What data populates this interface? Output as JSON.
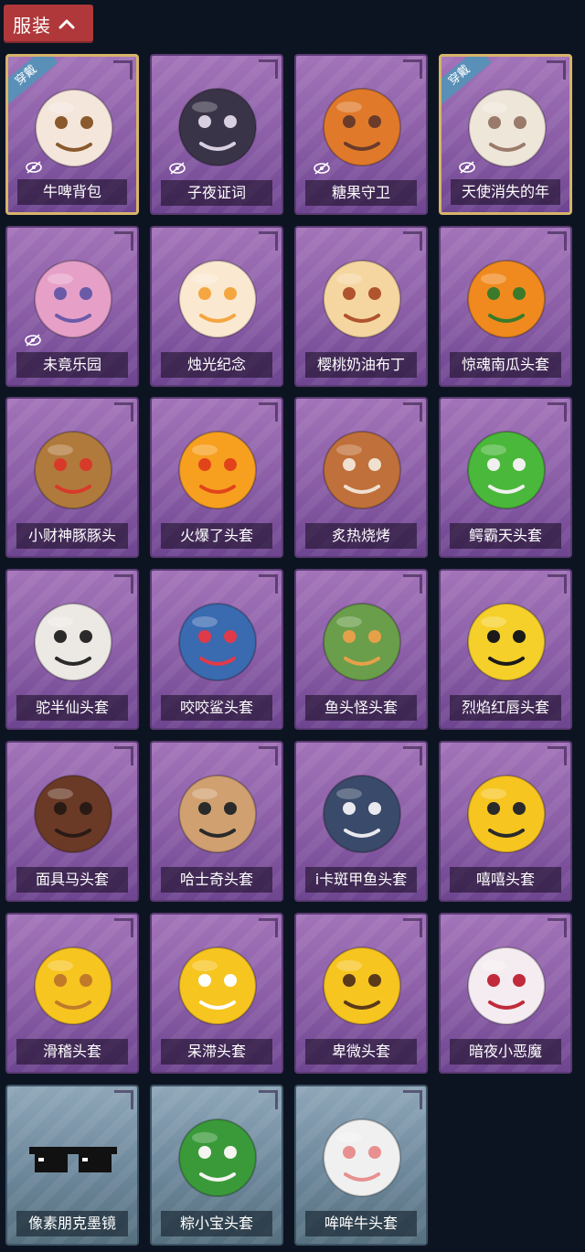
{
  "header": {
    "title": "服装"
  },
  "equipped_label": "穿戴",
  "items": [
    {
      "name": "牛啤背包",
      "icon": "cow-beer-backpack",
      "theme": "purple",
      "equipped": true,
      "hidden": true
    },
    {
      "name": "子夜证词",
      "icon": "owl-witch-figure",
      "theme": "purple",
      "equipped": false,
      "hidden": true
    },
    {
      "name": "糖果守卫",
      "icon": "pumpkin-scarecrow",
      "theme": "purple",
      "equipped": false,
      "hidden": true
    },
    {
      "name": "天使消失的年",
      "icon": "angel-girl",
      "theme": "purple",
      "equipped": true,
      "hidden": true
    },
    {
      "name": "未竟乐园",
      "icon": "pink-hair-girl",
      "theme": "purple",
      "equipped": false,
      "hidden": true
    },
    {
      "name": "烛光纪念",
      "icon": "candle-head",
      "theme": "purple",
      "equipped": false,
      "hidden": false
    },
    {
      "name": "樱桃奶油布丁",
      "icon": "cherry-pudding-head",
      "theme": "purple",
      "equipped": false,
      "hidden": false
    },
    {
      "name": "惊魂南瓜头套",
      "icon": "pumpkin-head",
      "theme": "purple",
      "equipped": false,
      "hidden": false
    },
    {
      "name": "小财神豚豚头",
      "icon": "capybara-head",
      "theme": "purple",
      "equipped": false,
      "hidden": false
    },
    {
      "name": "火爆了头套",
      "icon": "fire-head",
      "theme": "purple",
      "equipped": false,
      "hidden": false
    },
    {
      "name": "炙热烧烤",
      "icon": "bbq-meat-head",
      "theme": "purple",
      "equipped": false,
      "hidden": false
    },
    {
      "name": "鳄霸天头套",
      "icon": "crocodile-head",
      "theme": "purple",
      "equipped": false,
      "hidden": false
    },
    {
      "name": "驼半仙头套",
      "icon": "polar-bear-head",
      "theme": "purple",
      "equipped": false,
      "hidden": false
    },
    {
      "name": "咬咬鲨头套",
      "icon": "shark-head",
      "theme": "purple",
      "equipped": false,
      "hidden": false
    },
    {
      "name": "鱼头怪头套",
      "icon": "fish-head",
      "theme": "purple",
      "equipped": false,
      "hidden": false
    },
    {
      "name": "烈焰红唇头套",
      "icon": "pikachu-mask-head",
      "theme": "purple",
      "equipped": false,
      "hidden": false
    },
    {
      "name": "面具马头套",
      "icon": "horse-head",
      "theme": "purple",
      "equipped": false,
      "hidden": false
    },
    {
      "name": "哈士奇头套",
      "icon": "husky-head",
      "theme": "purple",
      "equipped": false,
      "hidden": false
    },
    {
      "name": "i卡斑甲鱼头套",
      "icon": "whale-head",
      "theme": "purple",
      "equipped": false,
      "hidden": false
    },
    {
      "name": "嘻嘻头套",
      "icon": "grin-emoji-head",
      "theme": "purple",
      "equipped": false,
      "hidden": false
    },
    {
      "name": "滑稽头套",
      "icon": "smirk-emoji-head",
      "theme": "purple",
      "equipped": false,
      "hidden": false
    },
    {
      "name": "呆滞头套",
      "icon": "stare-emoji-head",
      "theme": "purple",
      "equipped": false,
      "hidden": false
    },
    {
      "name": "卑微头套",
      "icon": "pleading-emoji-head",
      "theme": "purple",
      "equipped": false,
      "hidden": false
    },
    {
      "name": "暗夜小恶魔",
      "icon": "little-devil-head",
      "theme": "purple",
      "equipped": false,
      "hidden": false
    },
    {
      "name": "像素朋克墨镜",
      "icon": "pixel-sunglasses",
      "theme": "blue",
      "equipped": false,
      "hidden": false
    },
    {
      "name": "粽小宝头套",
      "icon": "zongzi-head",
      "theme": "blue",
      "equipped": false,
      "hidden": false
    },
    {
      "name": "哞哞牛头套",
      "icon": "cow-head",
      "theme": "blue",
      "equipped": false,
      "hidden": false
    }
  ]
}
